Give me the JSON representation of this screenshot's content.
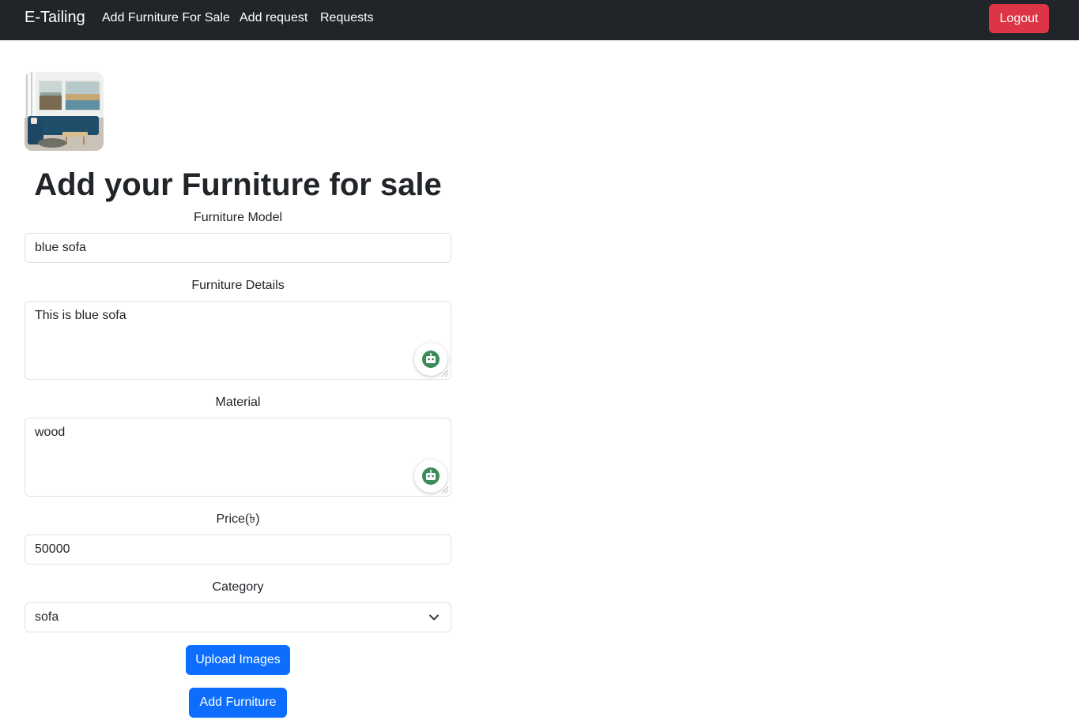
{
  "navbar": {
    "brand": "E-Tailing",
    "links": [
      {
        "label": "Add Furniture For Sale"
      },
      {
        "label": "Add request"
      },
      {
        "label": "Requests"
      }
    ],
    "logout_label": "Logout"
  },
  "colors": {
    "navbar_bg": "#212529",
    "logout": "#dc3545",
    "primary": "#0d6efd",
    "assistant_icon": "#3d8b5a"
  },
  "icons": {
    "assistant": "robot-assistant-icon",
    "select": "chevron-down-icon"
  },
  "main": {
    "title": "Add your Furniture for sale",
    "fields": {
      "model": {
        "label": "Furniture Model",
        "value": "blue sofa"
      },
      "details": {
        "label": "Furniture Details",
        "value": "This is blue sofa"
      },
      "material": {
        "label": "Material",
        "value": "wood"
      },
      "price": {
        "label": "Price(৳)",
        "value": "50000"
      },
      "category": {
        "label": "Category",
        "value": "sofa"
      }
    },
    "upload_label": "Upload Images",
    "submit_label": "Add Furniture"
  }
}
